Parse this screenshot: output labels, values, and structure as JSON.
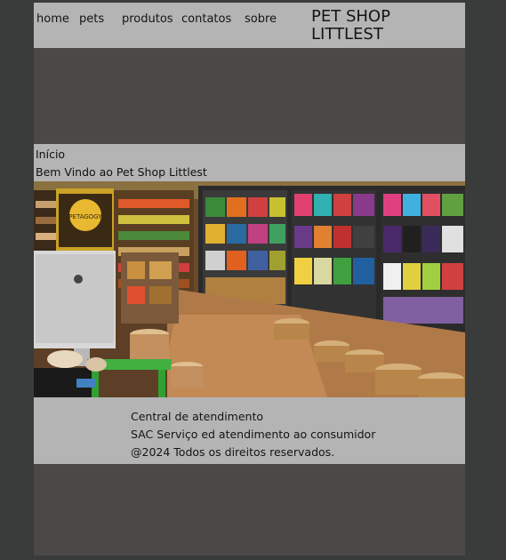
{
  "nav": {
    "items": [
      "home",
      "pets",
      "produtos",
      "contatos",
      "sobre"
    ]
  },
  "brand": {
    "line1": "PET SHOP",
    "line2": "LITTLEST"
  },
  "intro": {
    "breadcrumb": "Início",
    "welcome": "Bem Vindo ao Pet Shop Littlest"
  },
  "hero": {
    "sign_text": "PETAGOGY",
    "description": "photo of pet shop interior with shelves of pet food and baskets"
  },
  "footer": {
    "line1": "Central de atendimento",
    "line2": "SAC Serviço ed atendimento ao consumidor",
    "line3": "@2024 Todos os direitos reservados."
  }
}
